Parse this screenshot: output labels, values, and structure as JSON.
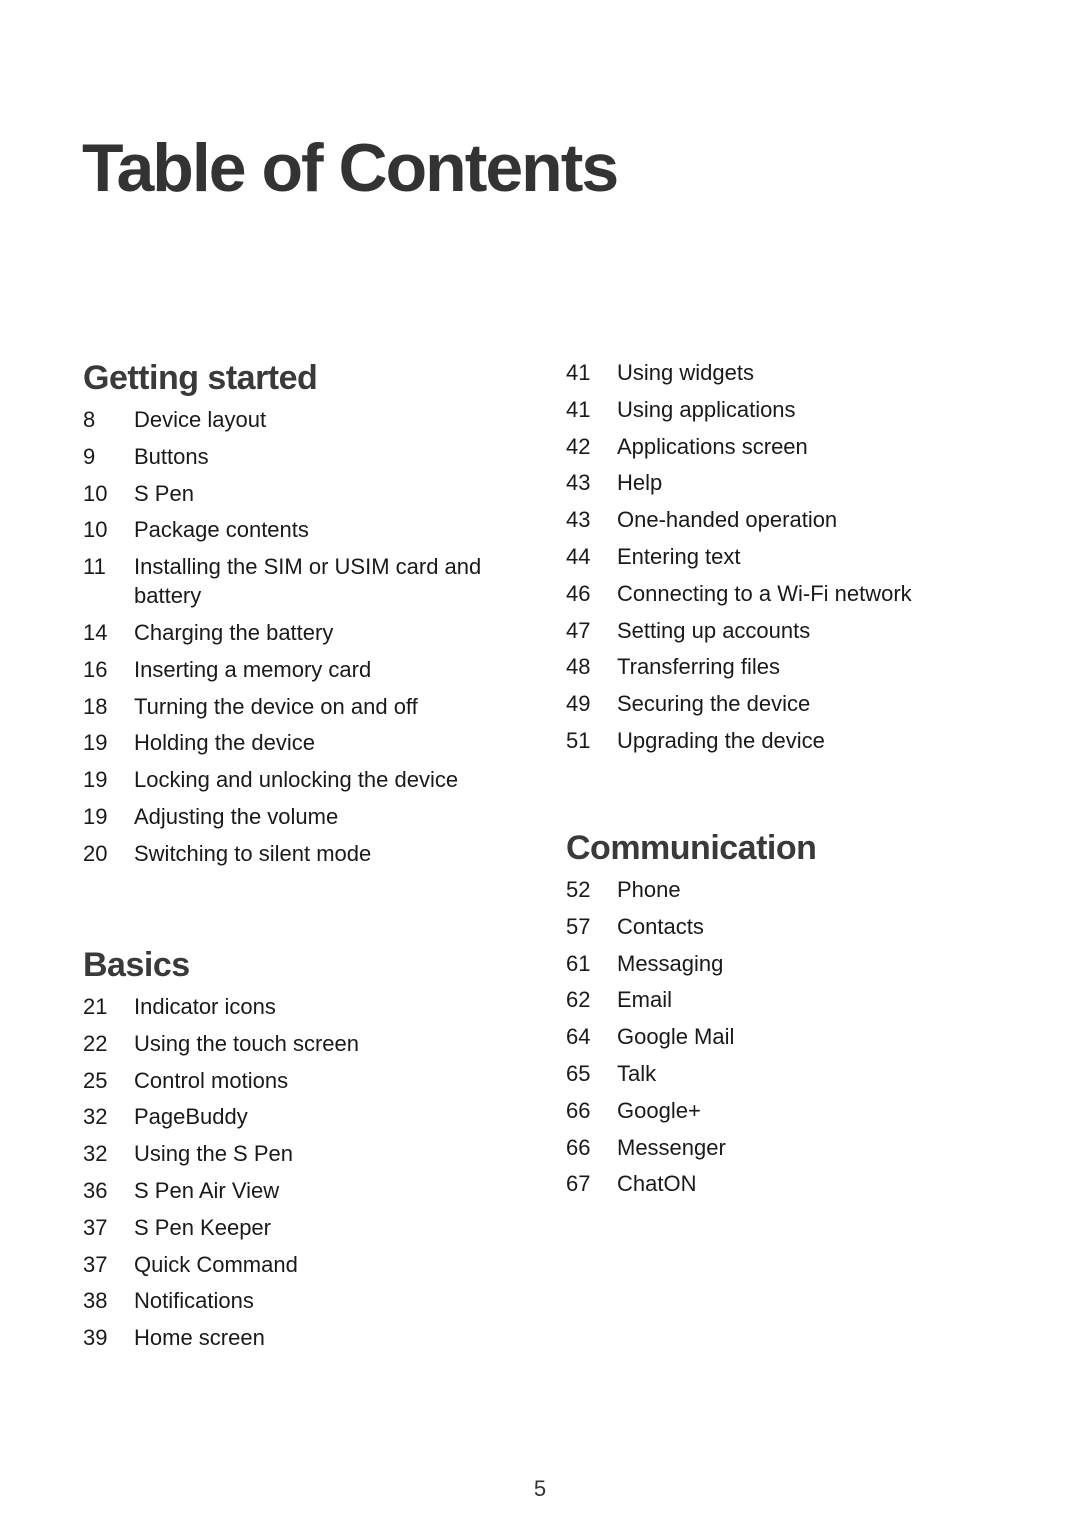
{
  "title": "Table of Contents",
  "sections": {
    "getting_started": {
      "heading": "Getting started",
      "entries": [
        {
          "page": "8",
          "label": "Device layout"
        },
        {
          "page": "9",
          "label": "Buttons"
        },
        {
          "page": "10",
          "label": "S Pen"
        },
        {
          "page": "10",
          "label": "Package contents"
        },
        {
          "page": "11",
          "label": "Installing the SIM or USIM card and battery"
        },
        {
          "page": "14",
          "label": "Charging the battery"
        },
        {
          "page": "16",
          "label": "Inserting a memory card"
        },
        {
          "page": "18",
          "label": "Turning the device on and off"
        },
        {
          "page": "19",
          "label": "Holding the device"
        },
        {
          "page": "19",
          "label": "Locking and unlocking the device"
        },
        {
          "page": "19",
          "label": "Adjusting the volume"
        },
        {
          "page": "20",
          "label": "Switching to silent mode"
        }
      ]
    },
    "basics": {
      "heading": "Basics",
      "entries": [
        {
          "page": "21",
          "label": "Indicator icons"
        },
        {
          "page": "22",
          "label": "Using the touch screen"
        },
        {
          "page": "25",
          "label": "Control motions"
        },
        {
          "page": "32",
          "label": "PageBuddy"
        },
        {
          "page": "32",
          "label": "Using the S Pen"
        },
        {
          "page": "36",
          "label": "S Pen Air View"
        },
        {
          "page": "37",
          "label": "S Pen Keeper"
        },
        {
          "page": "37",
          "label": "Quick Command"
        },
        {
          "page": "38",
          "label": "Notifications"
        },
        {
          "page": "39",
          "label": "Home screen"
        }
      ]
    },
    "basics_continued": {
      "entries": [
        {
          "page": "41",
          "label": "Using widgets"
        },
        {
          "page": "41",
          "label": "Using applications"
        },
        {
          "page": "42",
          "label": "Applications screen"
        },
        {
          "page": "43",
          "label": "Help"
        },
        {
          "page": "43",
          "label": "One-handed operation"
        },
        {
          "page": "44",
          "label": "Entering text"
        },
        {
          "page": "46",
          "label": "Connecting to a Wi-Fi network"
        },
        {
          "page": "47",
          "label": "Setting up accounts"
        },
        {
          "page": "48",
          "label": "Transferring files"
        },
        {
          "page": "49",
          "label": "Securing the device"
        },
        {
          "page": "51",
          "label": "Upgrading the device"
        }
      ]
    },
    "communication": {
      "heading": "Communication",
      "entries": [
        {
          "page": "52",
          "label": "Phone"
        },
        {
          "page": "57",
          "label": "Contacts"
        },
        {
          "page": "61",
          "label": "Messaging"
        },
        {
          "page": "62",
          "label": "Email"
        },
        {
          "page": "64",
          "label": "Google Mail"
        },
        {
          "page": "65",
          "label": "Talk"
        },
        {
          "page": "66",
          "label": "Google+"
        },
        {
          "page": "66",
          "label": "Messenger"
        },
        {
          "page": "67",
          "label": "ChatON"
        }
      ]
    }
  },
  "page_number": "5"
}
